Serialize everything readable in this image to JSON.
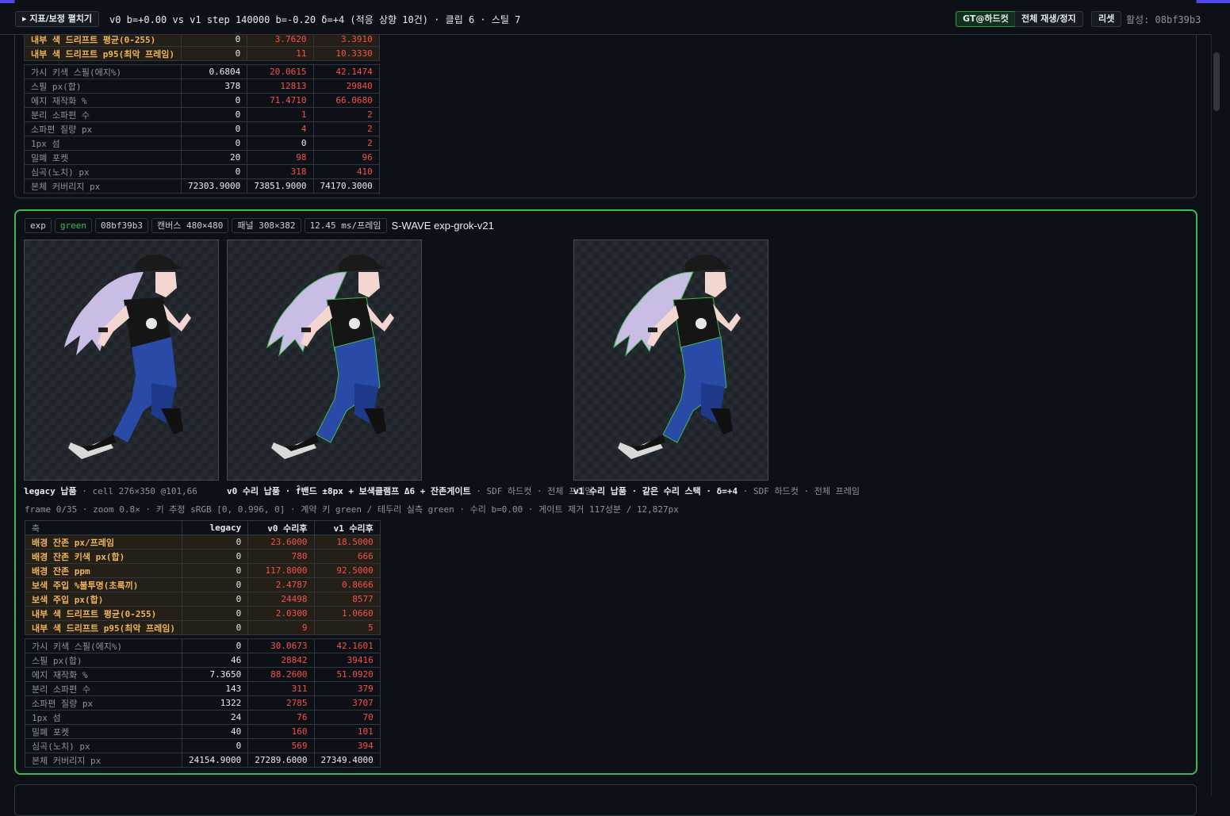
{
  "header": {
    "toggle_label": "▸ 지표/보정 펼치기",
    "summary": "v0 b=+0.00 vs v1 step 140000 b=-0.20 δ=+4 (적응 상향 10건) · 클립 6 · 스틸 7",
    "gt_button": "GT@하드컷",
    "play_button": "전체 재생/정지",
    "reset_button": "리셋",
    "active_label": "활성: 08bf39b3"
  },
  "colors": {
    "accent_green": "#3fb950",
    "accent_bar": "#4f46e5",
    "bad_value": "#f85149",
    "highlight_label": "#f0b45a"
  },
  "card_a": {
    "rows": [
      {
        "label": "내부 색 드리프트 평균(0-255)",
        "legacy": "0",
        "v0": "3.7620",
        "v1": "3.3910",
        "hl": true
      },
      {
        "label": "내부 색 드리프트 p95(최악 프레임)",
        "legacy": "0",
        "v0": "11",
        "v1": "10.3330",
        "hl": true
      },
      {
        "label": "가시 키색 스필(에지%)",
        "legacy": "0.6804",
        "v0": "20.0615",
        "v1": "42.1474",
        "gap": true
      },
      {
        "label": "스필 px(합)",
        "legacy": "378",
        "v0": "12813",
        "v1": "29840"
      },
      {
        "label": "에지 재작화 %",
        "legacy": "0",
        "v0": "71.4710",
        "v1": "66.0680"
      },
      {
        "label": "분리 소파편 수",
        "legacy": "0",
        "v0": "1",
        "v1": "2"
      },
      {
        "label": "소파편 질량 px",
        "legacy": "0",
        "v0": "4",
        "v1": "2"
      },
      {
        "label": "1px 섬",
        "legacy": "0",
        "v0": "0",
        "v1": "2",
        "v0white": true
      },
      {
        "label": "밀폐 포켓",
        "legacy": "20",
        "v0": "98",
        "v1": "96"
      },
      {
        "label": "심곡(노치) px",
        "legacy": "0",
        "v0": "318",
        "v1": "410"
      },
      {
        "label": "본체 커버리지 px",
        "legacy": "72303.9000",
        "v0": "73851.9000",
        "v1": "74170.3000",
        "allwhite": true
      }
    ]
  },
  "card_b": {
    "chips": [
      "exp",
      "green",
      "08bf39b3",
      "캔버스 480×480",
      "패널 308×382",
      "12.45 ms/프레임"
    ],
    "title": "S-WAVE exp-grok-v21",
    "captions": {
      "legacy_bold": "legacy 납품",
      "legacy_rest": " · cell 276×350 @101,66",
      "v0_bold": "v0 수리 납품 · f̂밴드 ±8px + 보색클램프 Δ6 + 잔존게이트",
      "v0_rest": " · SDF 하드컷 · 전체 프레임",
      "v1_bold": "v1 수리 납품 · 같은 수리 스택 · δ=+4",
      "v1_rest": " · SDF 하드컷 · 전체 프레임"
    },
    "info_line": "frame 0/35 · zoom 0.8× · 키 추정 sRGB [0, 0.996, 0] · 계약 키 green / 테두리 실측 green · 수리 b=0.00 · 게이트 제거 117성분 / 12,827px",
    "table_header": {
      "axis": "축",
      "legacy": "legacy",
      "v0": "v0 수리후",
      "v1": "v1 수리후"
    },
    "rows": [
      {
        "label": "배경 잔존 px/프레임",
        "legacy": "0",
        "v0": "23.6000",
        "v1": "18.5000",
        "hl": true
      },
      {
        "label": "배경 잔존 키색 px(합)",
        "legacy": "0",
        "v0": "780",
        "v1": "666",
        "hl": true
      },
      {
        "label": "배경 잔존 ppm",
        "legacy": "0",
        "v0": "117.8000",
        "v1": "92.5000",
        "hl": true
      },
      {
        "label": "보색 주입 %불투명(초록끼)",
        "legacy": "0",
        "v0": "2.4787",
        "v1": "0.8666",
        "hl": true
      },
      {
        "label": "보색 주입 px(합)",
        "legacy": "0",
        "v0": "24498",
        "v1": "8577",
        "hl": true
      },
      {
        "label": "내부 색 드리프트 평균(0-255)",
        "legacy": "0",
        "v0": "2.0300",
        "v1": "1.0660",
        "hl": true
      },
      {
        "label": "내부 색 드리프트 p95(최악 프레임)",
        "legacy": "0",
        "v0": "9",
        "v1": "5",
        "hl": true
      },
      {
        "label": "가시 키색 스필(에지%)",
        "legacy": "0",
        "v0": "30.0673",
        "v1": "42.1601",
        "gap": true
      },
      {
        "label": "스필 px(합)",
        "legacy": "46",
        "v0": "28842",
        "v1": "39416"
      },
      {
        "label": "에지 재작화 %",
        "legacy": "7.3650",
        "v0": "88.2600",
        "v1": "51.0920"
      },
      {
        "label": "분리 소파편 수",
        "legacy": "143",
        "v0": "311",
        "v1": "379"
      },
      {
        "label": "소파편 질량 px",
        "legacy": "1322",
        "v0": "2785",
        "v1": "3707"
      },
      {
        "label": "1px 섬",
        "legacy": "24",
        "v0": "76",
        "v1": "70"
      },
      {
        "label": "밀폐 포켓",
        "legacy": "40",
        "v0": "160",
        "v1": "101"
      },
      {
        "label": "심곡(노치) px",
        "legacy": "0",
        "v0": "569",
        "v1": "394"
      },
      {
        "label": "본체 커버리지 px",
        "legacy": "24154.9000",
        "v0": "27289.6000",
        "v1": "27349.4000",
        "allwhite": true
      }
    ]
  }
}
